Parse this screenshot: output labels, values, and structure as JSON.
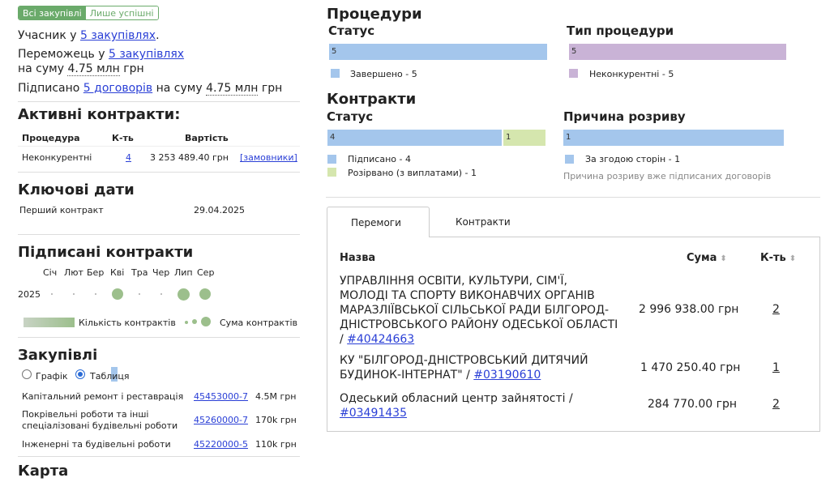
{
  "toggle": {
    "all": "Всі закупівлі",
    "success": "Лише успішні"
  },
  "summary": {
    "participant_prefix": "Учасник у",
    "participant_link": "5 закупівлях",
    "participant_suffix": ".",
    "winner_prefix": "Переможець у",
    "winner_link": "5 закупівлях",
    "winner_line2_prefix": "на суму",
    "winner_amount": "4.75 млн",
    "winner_currency": "грн",
    "signed_prefix": "Підписано",
    "signed_link": "5 договорів",
    "signed_mid": "на суму",
    "signed_amount": "4.75 млн",
    "signed_currency": "грн"
  },
  "active": {
    "title": "Активні контракти:",
    "headers": [
      "Процедура",
      "К-ть",
      "Вартість"
    ],
    "row": {
      "procedure": "Неконкурентні",
      "count": "4",
      "value": "3 253 489.40 грн",
      "link": "[замовники]"
    }
  },
  "dates": {
    "title": "Ключові дати",
    "label": "Перший контракт",
    "value": "29.04.2025"
  },
  "signed": {
    "title": "Підписані контракти",
    "months": [
      "Січ",
      "Лют",
      "Бер",
      "Кві",
      "Тра",
      "Чер",
      "Лип",
      "Сер"
    ],
    "year": "2025",
    "legend_count": "Кількість контрактів",
    "legend_sum": "Сума контрактів"
  },
  "purchases": {
    "title": "Закупівлі",
    "radio_graph": "Графік",
    "radio_table": "Таблиця",
    "rows": [
      {
        "name": "Капітальний ремонт і реставрація",
        "code": "45453000-7",
        "value": "4.5M грн"
      },
      {
        "name": "Покрівельні роботи та інші спеціалізовані будівельні роботи",
        "code": "45260000-7",
        "value": "170k грн"
      },
      {
        "name": "Інженерні та будівельні роботи",
        "code": "45220000-5",
        "value": "110k грн"
      }
    ]
  },
  "map": {
    "title": "Карта"
  },
  "procedures": {
    "title": "Процедури",
    "status_title": "Статус",
    "status_bar": "5",
    "status_legend": "Завершено - 5",
    "type_title": "Тип процедури",
    "type_bar": "5",
    "type_legend": "Неконкурентні - 5"
  },
  "contracts": {
    "title": "Контракти",
    "status_title": "Статус",
    "bar_signed": "4",
    "bar_terminated": "1",
    "legend_signed": "Підписано - 4",
    "legend_terminated": "Розірвано (з виплатами) - 1",
    "reason_title": "Причина розриву",
    "reason_bar": "1",
    "reason_legend": "За згодою сторін - 1",
    "reason_note": "Причина розриву вже підписаних договорів"
  },
  "tabs": {
    "wins": "Перемоги",
    "contracts": "Контракти"
  },
  "wins_table": {
    "headers": {
      "name": "Назва",
      "sum": "Сума",
      "count": "К-ть"
    },
    "rows": [
      {
        "name": "УПРАВЛІННЯ ОСВІТИ, КУЛЬТУРИ, СІМ'Ї, МОЛОДІ ТА СПОРТУ ВИКОНАВЧИХ ОРГАНІВ МАРАЗЛІЇВСЬКОЇ СІЛЬСЬКОЇ РАДИ БІЛГОРОД-ДНІСТРОВСЬКОГО РАЙОНУ ОДЕСЬКОЇ ОБЛАСТІ /",
        "code": "#40424663",
        "sum": "2 996 938.00 грн",
        "count": "2"
      },
      {
        "name": "КУ \"БІЛГОРОД-ДНІСТРОВСЬКИЙ ДИТЯЧИЙ БУДИНОК-ІНТЕРНАТ\" /",
        "code": "#03190610",
        "sum": "1 470 250.40 грн",
        "count": "1"
      },
      {
        "name": "Одеський обласний центр зайнятості /",
        "code": "#03491435",
        "sum": "284 770.00 грн",
        "count": "2"
      }
    ]
  },
  "colors": {
    "blue_bar": "#a4c6ec",
    "purple_bar": "#c9b3d6",
    "green_bar": "#d5e6ae",
    "green_dot": "#9cbf8c",
    "link": "#2a3fd6",
    "toggle": "#6aaa6a"
  }
}
